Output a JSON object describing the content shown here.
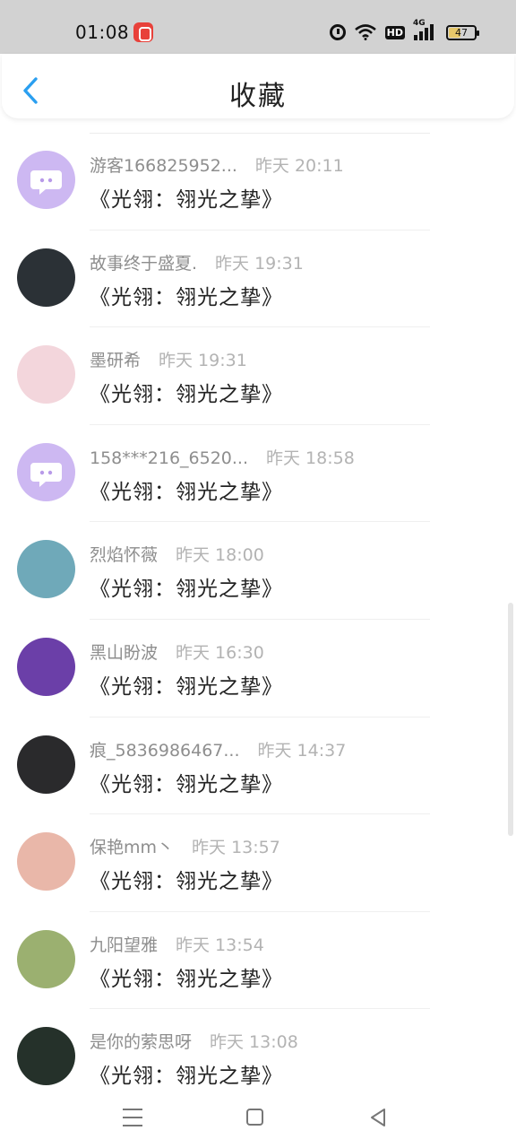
{
  "status_bar": {
    "time": "01:08",
    "network": "4G",
    "hd_label": "HD",
    "battery": "47"
  },
  "header": {
    "title": "收藏"
  },
  "favorites": [
    {
      "name": "游客166825952...",
      "time": "昨天 20:11",
      "title": "《光翎：翎光之挚》",
      "avatar": "chat-bubble-avatar",
      "avatar_color": "#cdb8f2"
    },
    {
      "name": "故事终于盛夏.",
      "time": "昨天 19:31",
      "title": "《光翎：翎光之挚》",
      "avatar": "cat-window-avatar",
      "avatar_color": "#2b3136"
    },
    {
      "name": "墨研希",
      "time": "昨天 19:31",
      "title": "《光翎：翎光之挚》",
      "avatar": "anime-girl-avatar",
      "avatar_color": "#f3d6dc"
    },
    {
      "name": "158***216_6520...",
      "time": "昨天 18:58",
      "title": "《光翎：翎光之挚》",
      "avatar": "chat-bubble-avatar",
      "avatar_color": "#cdb8f2"
    },
    {
      "name": "烈焰怀薇",
      "time": "昨天 18:00",
      "title": "《光翎：翎光之挚》",
      "avatar": "seaside-avatar",
      "avatar_color": "#6fa9b9"
    },
    {
      "name": "黑山盼波",
      "time": "昨天 16:30",
      "title": "《光翎：翎光之挚》",
      "avatar": "purple-flowers-avatar",
      "avatar_color": "#6b3fa8"
    },
    {
      "name": "痕_5836986467...",
      "time": "昨天 14:37",
      "title": "《光翎：翎光之挚》",
      "avatar": "dark-boy-avatar",
      "avatar_color": "#2a2a2c"
    },
    {
      "name": "保艳mm丶",
      "time": "昨天 13:57",
      "title": "《光翎：翎光之挚》",
      "avatar": "girl-photo-avatar",
      "avatar_color": "#e9b7a9"
    },
    {
      "name": "九阳望雅",
      "time": "昨天 13:54",
      "title": "《光翎：翎光之挚》",
      "avatar": "husky-dog-avatar",
      "avatar_color": "#9bb070"
    },
    {
      "name": "是你的萦思呀",
      "time": "昨天 13:08",
      "title": "《光翎：翎光之挚》",
      "avatar": "pink-flower-avatar",
      "avatar_color": "#25312a"
    }
  ]
}
